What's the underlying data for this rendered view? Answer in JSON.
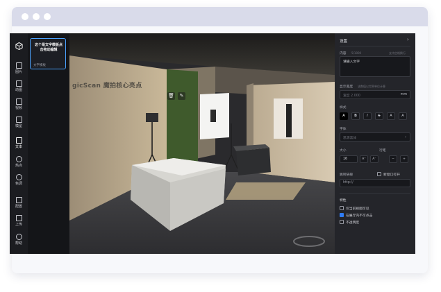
{
  "sidebar": {
    "items": [
      {
        "label": "图片"
      },
      {
        "label": "动图"
      },
      {
        "label": "视频"
      },
      {
        "label": "模型"
      },
      {
        "label": "文本"
      },
      {
        "label": "热点"
      },
      {
        "label": "色调"
      },
      {
        "label": "配置"
      },
      {
        "label": "上传"
      },
      {
        "label": "帮助"
      }
    ]
  },
  "template_card": {
    "title": "这个是文字模板点击拖动编辑",
    "subtitle": "文字模板"
  },
  "scene": {
    "wall_text": "gicScan 魔拍核心亮点",
    "delete_icon": "trash-icon",
    "edit_icon": "pencil-icon"
  },
  "right_panel": {
    "title": "设置",
    "content_label": "内容",
    "content_count": "5/1000",
    "content_hint": "支持空格换行",
    "content_value": "请输入文字",
    "width_label": "显示宽度",
    "width_hint": "该数值以世界单位计算",
    "width_placeholder": "宽度 2.000",
    "width_unit": "mm",
    "style_label": "样式",
    "style_buttons": [
      "A",
      "B",
      "I",
      "S",
      "A",
      "A"
    ],
    "font_label": "字体",
    "font_value": "思源黑体",
    "size_label": "大小",
    "spacing_label": "行距",
    "size_value": "16",
    "link_label": "跳转链接",
    "new_window_label": "新窗口打开",
    "link_value": "http://",
    "features_label": "特性",
    "features": [
      {
        "label": "仅当前视图可见",
        "checked": false
      },
      {
        "label": "在展厅内不可点击",
        "checked": true
      },
      {
        "label": "不透明度",
        "checked": false
      }
    ]
  },
  "colors": {
    "accent": "#2f7cf6",
    "card_border": "#4aa2ff"
  }
}
